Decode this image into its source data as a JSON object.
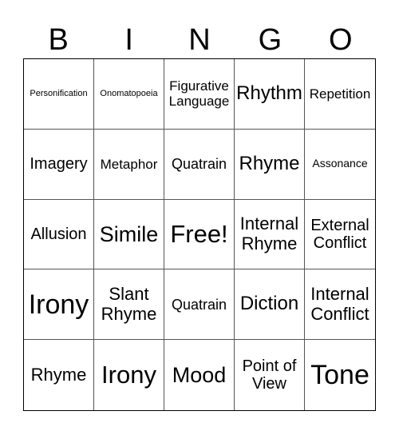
{
  "header": [
    "B",
    "I",
    "N",
    "G",
    "O"
  ],
  "cells": [
    "Personification",
    "Onomatopoeia",
    "Figurative Language",
    "Rhythm",
    "Repetition",
    "Imagery",
    "Metaphor",
    "Quatrain",
    "Rhyme",
    "Assonance",
    "Allusion",
    "Simile",
    "Free!",
    "Internal Rhyme",
    "External Conflict",
    "Irony",
    "Slant Rhyme",
    "Quatrain",
    "Diction",
    "Internal Conflict",
    "Rhyme",
    "Irony",
    "Mood",
    "Point of View",
    "Tone"
  ]
}
